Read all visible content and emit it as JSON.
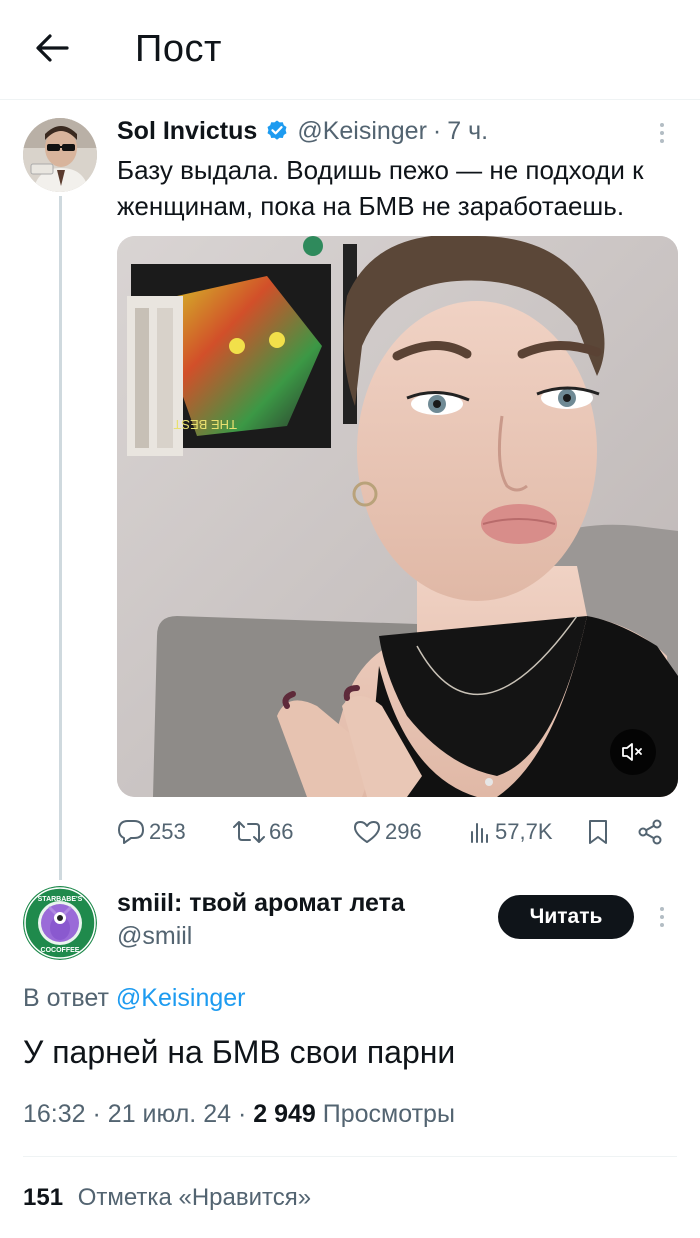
{
  "header": {
    "title": "Пост",
    "back_icon": "arrow-left-icon"
  },
  "tweet": {
    "author_name": "Sol Invictus",
    "verified_icon": "verified-badge-icon",
    "handle": "@Keisinger",
    "separator": "·",
    "time": "7 ч.",
    "text": "Базу выдала. Водишь пежо — не подходи к женщинам, пока на БМВ не заработаешь.",
    "media": {
      "type": "video",
      "mute_icon": "volume-muted-icon",
      "poster_text": "THE BEST"
    },
    "actions": {
      "replies": "253",
      "reposts": "66",
      "likes": "296",
      "views": "57,7K",
      "icons": [
        "reply-icon",
        "repost-icon",
        "like-icon",
        "views-icon",
        "bookmark-icon",
        "share-icon"
      ]
    }
  },
  "reply": {
    "author_name": "smiil: твой аромат лета",
    "handle": "@smiil",
    "avatar_label_top": "STARBABE'S",
    "avatar_label_bottom": "COCOFFEE",
    "follow_label": "Читать",
    "reply_prefix": "В ответ",
    "reply_to": "@Keisinger",
    "text": "У парней на БМВ свои парни",
    "time": "16:32",
    "date": "21 июл. 24",
    "sep": "·",
    "views_count": "2 949",
    "views_label": "Просмотры",
    "likes_count": "151",
    "likes_label": "Отметка «Нравится»"
  },
  "colors": {
    "accent": "#1d9bf0",
    "text_primary": "#0f1419",
    "text_secondary": "#536471",
    "divider": "#eff3f4",
    "button_dark": "#0f1419"
  }
}
